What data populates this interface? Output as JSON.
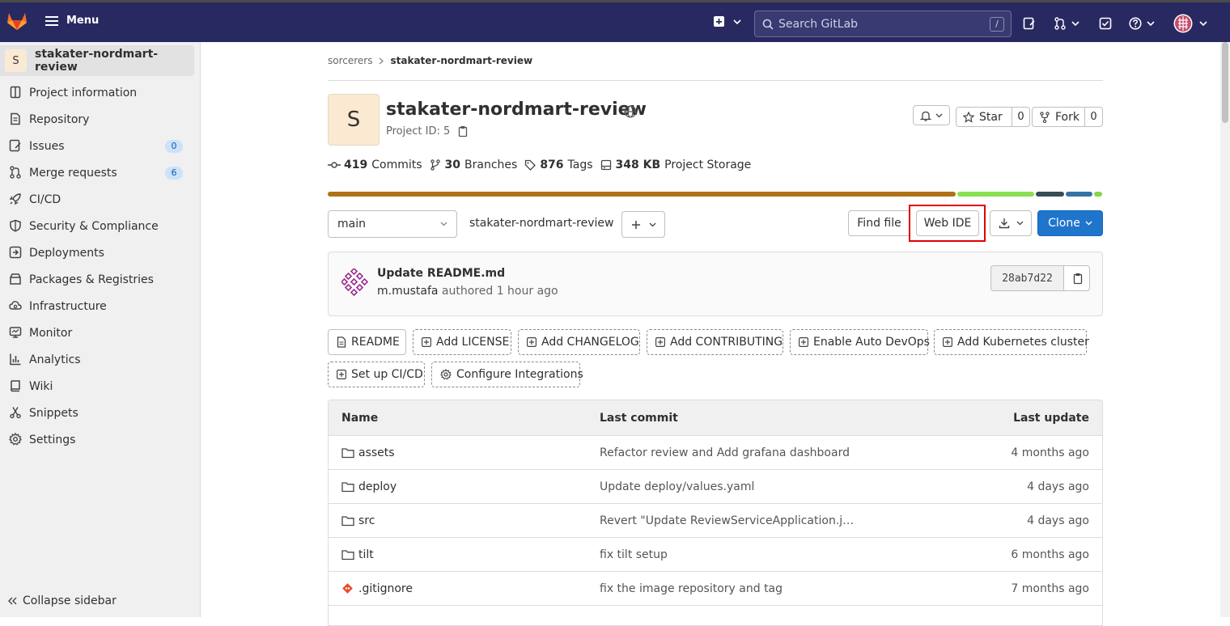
{
  "topbar": {
    "menu_label": "Menu",
    "search_placeholder": "Search GitLab",
    "search_shortcut": "/"
  },
  "sidebar": {
    "project_initial": "S",
    "project_name": "stakater-nordmart-review",
    "items": [
      {
        "label": "Project information",
        "icon": "info-icon"
      },
      {
        "label": "Repository",
        "icon": "doc-icon"
      },
      {
        "label": "Issues",
        "icon": "issues-icon",
        "badge": "0"
      },
      {
        "label": "Merge requests",
        "icon": "merge-request-icon",
        "badge": "6"
      },
      {
        "label": "CI/CD",
        "icon": "rocket-icon"
      },
      {
        "label": "Security & Compliance",
        "icon": "shield-icon"
      },
      {
        "label": "Deployments",
        "icon": "deployments-icon"
      },
      {
        "label": "Packages & Registries",
        "icon": "package-icon"
      },
      {
        "label": "Infrastructure",
        "icon": "cloud-icon"
      },
      {
        "label": "Monitor",
        "icon": "monitor-icon"
      },
      {
        "label": "Analytics",
        "icon": "chart-icon"
      },
      {
        "label": "Wiki",
        "icon": "book-icon"
      },
      {
        "label": "Snippets",
        "icon": "scissors-icon"
      },
      {
        "label": "Settings",
        "icon": "gear-icon"
      }
    ],
    "collapse_label": "Collapse sidebar"
  },
  "breadcrumb": {
    "parent": "sorcerers",
    "current": "stakater-nordmart-review"
  },
  "project": {
    "initial": "S",
    "title": "stakater-nordmart-review",
    "id_text": "Project ID: 5",
    "notify_label": "",
    "star_label": "Star",
    "star_count": "0",
    "fork_label": "Fork",
    "fork_count": "0"
  },
  "stats": {
    "commits_count": "419",
    "commits_label": "Commits",
    "branches_count": "30",
    "branches_label": "Branches",
    "tags_count": "876",
    "tags_label": "Tags",
    "storage_count": "348 KB",
    "storage_label": "Project Storage"
  },
  "language_bar": [
    {
      "color": "#b07219",
      "share": 0.817
    },
    {
      "color": "#89e051",
      "share": 0.1
    },
    {
      "color": "#384d54",
      "share": 0.037
    },
    {
      "color": "#3572a5",
      "share": 0.035
    },
    {
      "color": "#88d34a",
      "share": 0.011
    }
  ],
  "repo_toolbar": {
    "branch": "main",
    "path": "stakater-nordmart-review",
    "path_sep": "/",
    "find_file": "Find file",
    "web_ide": "Web IDE",
    "clone": "Clone"
  },
  "last_commit": {
    "title": "Update README.md",
    "author": "m.mustafa",
    "meta": "authored 1 hour ago",
    "sha": "28ab7d22"
  },
  "quick_actions": {
    "readme": "README",
    "add_license": "Add LICENSE",
    "add_changelog": "Add CHANGELOG",
    "add_contributing": "Add CONTRIBUTING",
    "auto_devops": "Enable Auto DevOps",
    "add_k8s": "Add Kubernetes cluster",
    "setup_ci": "Set up CI/CD",
    "integrations": "Configure Integrations"
  },
  "file_table": {
    "headers": {
      "name": "Name",
      "last_commit": "Last commit",
      "last_update": "Last update"
    },
    "rows": [
      {
        "name": "assets",
        "type": "folder",
        "commit": "Refactor review and Add grafana dashboard",
        "updated": "4 months ago"
      },
      {
        "name": "deploy",
        "type": "folder",
        "commit": "Update deploy/values.yaml",
        "updated": "4 days ago"
      },
      {
        "name": "src",
        "type": "folder",
        "commit": "Revert \"Update ReviewServiceApplication.j…",
        "updated": "4 days ago"
      },
      {
        "name": "tilt",
        "type": "folder",
        "commit": "fix tilt setup",
        "updated": "6 months ago"
      },
      {
        "name": ".gitignore",
        "type": "git-file",
        "commit": "fix the image repository and tag",
        "updated": "7 months ago"
      }
    ]
  },
  "colors": {
    "topbar": "#292961",
    "primary": "#1f75cb",
    "highlight": "#e00000"
  }
}
